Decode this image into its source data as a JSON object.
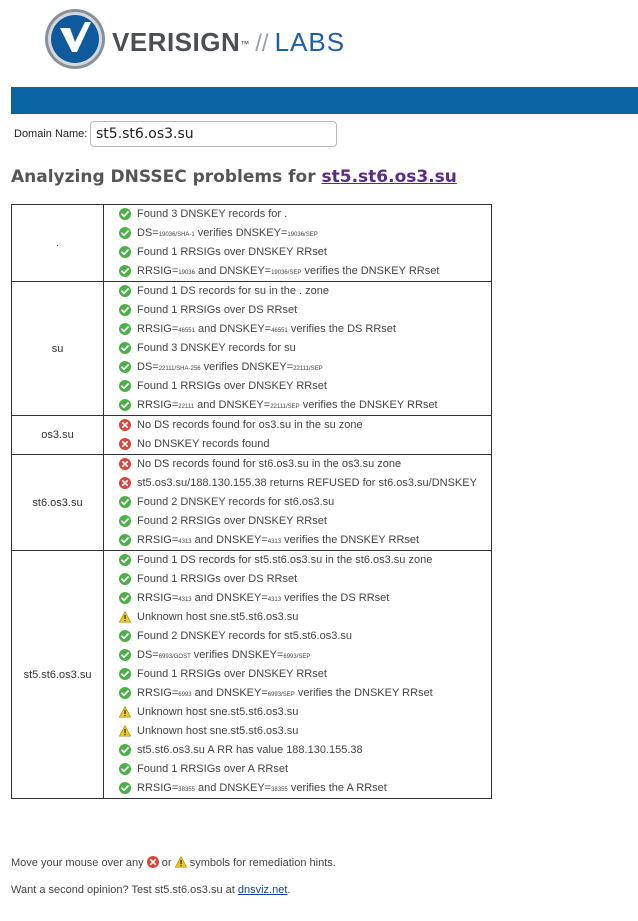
{
  "logo": {
    "brand": "VERISIGN",
    "trademark": "™",
    "separator": "//",
    "product": "LABS"
  },
  "search": {
    "label": "Domain Name:",
    "value": "st5.st6.os3.su"
  },
  "heading": {
    "prefix": "Analyzing DNSSEC problems for ",
    "domain": "st5.st6.os3.su"
  },
  "zones": [
    {
      "name": ".",
      "checks": [
        {
          "status": "ok",
          "parts": [
            [
              "t",
              "Found 3 DNSKEY records for ."
            ]
          ]
        },
        {
          "status": "ok",
          "parts": [
            [
              "t",
              "DS="
            ],
            [
              "s",
              "19036/SHA-1"
            ],
            [
              "t",
              " verifies DNSKEY="
            ],
            [
              "s",
              "19036/SEP"
            ]
          ]
        },
        {
          "status": "ok",
          "parts": [
            [
              "t",
              "Found 1 RRSIGs over DNSKEY RRset"
            ]
          ]
        },
        {
          "status": "ok",
          "parts": [
            [
              "t",
              "RRSIG="
            ],
            [
              "s",
              "19036"
            ],
            [
              "t",
              " and DNSKEY="
            ],
            [
              "s",
              "19036/SEP"
            ],
            [
              "t",
              " verifies the DNSKEY RRset"
            ]
          ]
        }
      ]
    },
    {
      "name": "su",
      "checks": [
        {
          "status": "ok",
          "parts": [
            [
              "t",
              "Found 1 DS records for su in the . zone"
            ]
          ]
        },
        {
          "status": "ok",
          "parts": [
            [
              "t",
              "Found 1 RRSIGs over DS RRset"
            ]
          ]
        },
        {
          "status": "ok",
          "parts": [
            [
              "t",
              "RRSIG="
            ],
            [
              "s",
              "46551"
            ],
            [
              "t",
              " and DNSKEY="
            ],
            [
              "s",
              "46551"
            ],
            [
              "t",
              " verifies the DS RRset"
            ]
          ]
        },
        {
          "status": "ok",
          "parts": [
            [
              "t",
              "Found 3 DNSKEY records for su"
            ]
          ]
        },
        {
          "status": "ok",
          "parts": [
            [
              "t",
              "DS="
            ],
            [
              "s",
              "22111/SHA-256"
            ],
            [
              "t",
              " verifies DNSKEY="
            ],
            [
              "s",
              "22111/SEP"
            ]
          ]
        },
        {
          "status": "ok",
          "parts": [
            [
              "t",
              "Found 1 RRSIGs over DNSKEY RRset"
            ]
          ]
        },
        {
          "status": "ok",
          "parts": [
            [
              "t",
              "RRSIG="
            ],
            [
              "s",
              "22111"
            ],
            [
              "t",
              " and DNSKEY="
            ],
            [
              "s",
              "22111/SEP"
            ],
            [
              "t",
              " verifies the DNSKEY RRset"
            ]
          ]
        }
      ]
    },
    {
      "name": "os3.su",
      "checks": [
        {
          "status": "error",
          "parts": [
            [
              "t",
              "No DS records found for os3.su in the su zone"
            ]
          ]
        },
        {
          "status": "error",
          "parts": [
            [
              "t",
              "No DNSKEY records found"
            ]
          ]
        }
      ]
    },
    {
      "name": "st6.os3.su",
      "checks": [
        {
          "status": "error",
          "parts": [
            [
              "t",
              "No DS records found for st6.os3.su in the os3.su zone"
            ]
          ]
        },
        {
          "status": "error",
          "parts": [
            [
              "t",
              "st5.os3.su/188.130.155.38 returns REFUSED for st6.os3.su/DNSKEY"
            ]
          ]
        },
        {
          "status": "ok",
          "parts": [
            [
              "t",
              "Found 2 DNSKEY records for st6.os3.su"
            ]
          ]
        },
        {
          "status": "ok",
          "parts": [
            [
              "t",
              "Found 2 RRSIGs over DNSKEY RRset"
            ]
          ]
        },
        {
          "status": "ok",
          "parts": [
            [
              "t",
              "RRSIG="
            ],
            [
              "s",
              "4313"
            ],
            [
              "t",
              " and DNSKEY="
            ],
            [
              "s",
              "4313"
            ],
            [
              "t",
              " verifies the DNSKEY RRset"
            ]
          ]
        }
      ]
    },
    {
      "name": "st5.st6.os3.su",
      "checks": [
        {
          "status": "ok",
          "parts": [
            [
              "t",
              "Found 1 DS records for st5.st6.os3.su in the st6.os3.su zone"
            ]
          ]
        },
        {
          "status": "ok",
          "parts": [
            [
              "t",
              "Found 1 RRSIGs over DS RRset"
            ]
          ]
        },
        {
          "status": "ok",
          "parts": [
            [
              "t",
              "RRSIG="
            ],
            [
              "s",
              "4313"
            ],
            [
              "t",
              " and DNSKEY="
            ],
            [
              "s",
              "4313"
            ],
            [
              "t",
              " verifies the DS RRset"
            ]
          ]
        },
        {
          "status": "warn",
          "parts": [
            [
              "t",
              "Unknown host sne.st5.st6.os3.su"
            ]
          ]
        },
        {
          "status": "ok",
          "parts": [
            [
              "t",
              "Found 2 DNSKEY records for st5.st6.os3.su"
            ]
          ]
        },
        {
          "status": "ok",
          "parts": [
            [
              "t",
              "DS="
            ],
            [
              "s",
              "6993/GOST"
            ],
            [
              "t",
              " verifies DNSKEY="
            ],
            [
              "s",
              "6993/SEP"
            ]
          ]
        },
        {
          "status": "ok",
          "parts": [
            [
              "t",
              "Found 1 RRSIGs over DNSKEY RRset"
            ]
          ]
        },
        {
          "status": "ok",
          "parts": [
            [
              "t",
              "RRSIG="
            ],
            [
              "s",
              "6993"
            ],
            [
              "t",
              " and DNSKEY="
            ],
            [
              "s",
              "6993/SEP"
            ],
            [
              "t",
              " verifies the DNSKEY RRset"
            ]
          ]
        },
        {
          "status": "warn",
          "parts": [
            [
              "t",
              "Unknown host sne.st5.st6.os3.su"
            ]
          ]
        },
        {
          "status": "warn",
          "parts": [
            [
              "t",
              "Unknown host sne.st5.st6.os3.su"
            ]
          ]
        },
        {
          "status": "ok",
          "parts": [
            [
              "t",
              "st5.st6.os3.su A RR has value 188.130.155.38"
            ]
          ]
        },
        {
          "status": "ok",
          "parts": [
            [
              "t",
              "Found 1 RRSIGs over A RRset"
            ]
          ]
        },
        {
          "status": "ok",
          "parts": [
            [
              "t",
              "RRSIG="
            ],
            [
              "s",
              "38355"
            ],
            [
              "t",
              " and DNSKEY="
            ],
            [
              "s",
              "38355"
            ],
            [
              "t",
              " verifies the A RRset"
            ]
          ]
        }
      ]
    }
  ],
  "footer": {
    "hint_prefix": "Move your mouse over any ",
    "hint_or": " or ",
    "hint_suffix": " symbols for remediation hints.",
    "opinion_prefix": "Want a second opinion? Test st5.st6.os3.su at ",
    "opinion_link": "dnsviz.net",
    "opinion_suffix": "."
  },
  "colors": {
    "banner": "#0a64a4",
    "ok": "#4caf4a",
    "error": "#d9463c",
    "warn": "#f2c81c",
    "heading_link": "#5b2c86"
  },
  "icons": {
    "ok": "check-icon",
    "error": "error-icon",
    "warn": "warning-icon"
  }
}
